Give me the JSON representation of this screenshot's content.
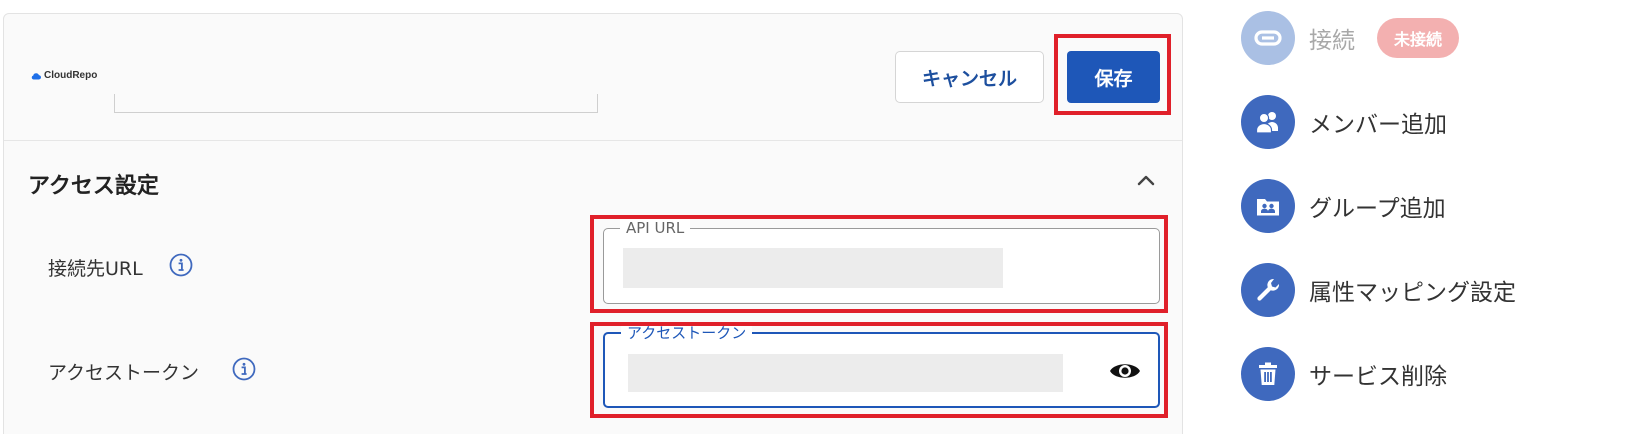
{
  "header": {
    "logo_text": "CloudRepo",
    "cancel_label": "キャンセル",
    "save_label": "保存"
  },
  "access_settings": {
    "title": "アクセス設定",
    "api_url": {
      "label": "接続先URL",
      "field_legend": "API URL"
    },
    "access_token": {
      "label": "アクセストークン",
      "field_legend": "アクセストークン"
    }
  },
  "side_menu": {
    "connect": {
      "label": "接続",
      "status_badge": "未接続",
      "icon": "link-icon"
    },
    "add_member": {
      "label": "メンバー追加",
      "icon": "people-icon"
    },
    "add_group": {
      "label": "グループ追加",
      "icon": "group-folder-icon"
    },
    "attribute_mapping": {
      "label": "属性マッピング設定",
      "icon": "wrench-icon"
    },
    "delete_service": {
      "label": "サービス削除",
      "icon": "trash-icon"
    }
  },
  "colors": {
    "primary": "#1e57b8",
    "menu_icon_bg": "#3f69be",
    "highlight": "#e0202a",
    "badge_bg": "#f3b0b0"
  }
}
